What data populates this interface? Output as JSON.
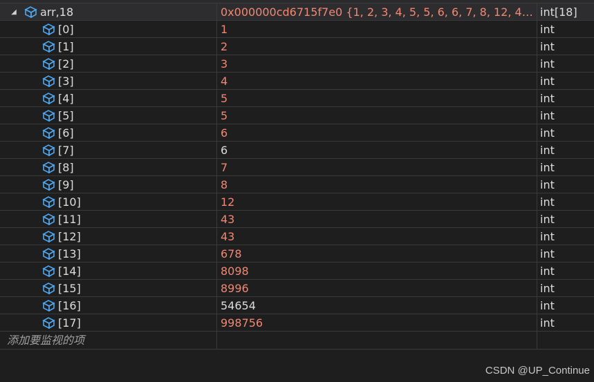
{
  "parent": {
    "name": "arr,18",
    "value": "0x000000cd6715f7e0 {1, 2, 3, 4, 5, 5, 6, 6, 7, 8, 12, 43, 4...",
    "type": "int[18]"
  },
  "items": [
    {
      "name": "[0]",
      "value": "1",
      "type": "int",
      "changed": true
    },
    {
      "name": "[1]",
      "value": "2",
      "type": "int",
      "changed": true
    },
    {
      "name": "[2]",
      "value": "3",
      "type": "int",
      "changed": true
    },
    {
      "name": "[3]",
      "value": "4",
      "type": "int",
      "changed": true
    },
    {
      "name": "[4]",
      "value": "5",
      "type": "int",
      "changed": true
    },
    {
      "name": "[5]",
      "value": "5",
      "type": "int",
      "changed": true
    },
    {
      "name": "[6]",
      "value": "6",
      "type": "int",
      "changed": true
    },
    {
      "name": "[7]",
      "value": "6",
      "type": "int",
      "changed": false
    },
    {
      "name": "[8]",
      "value": "7",
      "type": "int",
      "changed": true
    },
    {
      "name": "[9]",
      "value": "8",
      "type": "int",
      "changed": true
    },
    {
      "name": "[10]",
      "value": "12",
      "type": "int",
      "changed": true
    },
    {
      "name": "[11]",
      "value": "43",
      "type": "int",
      "changed": true
    },
    {
      "name": "[12]",
      "value": "43",
      "type": "int",
      "changed": true
    },
    {
      "name": "[13]",
      "value": "678",
      "type": "int",
      "changed": true
    },
    {
      "name": "[14]",
      "value": "8098",
      "type": "int",
      "changed": true
    },
    {
      "name": "[15]",
      "value": "8996",
      "type": "int",
      "changed": true
    },
    {
      "name": "[16]",
      "value": "54654",
      "type": "int",
      "changed": false
    },
    {
      "name": "[17]",
      "value": "998756",
      "type": "int",
      "changed": true
    }
  ],
  "add_item_placeholder": "添加要监视的项",
  "watermark": "CSDN @UP_Continue",
  "colors": {
    "changed": "#f48771",
    "unchanged": "#dcdcdc",
    "icon": "#4fa6ef"
  },
  "icons": {
    "expander": "collapse-triangle-icon",
    "variable": "variable-cube-icon"
  }
}
